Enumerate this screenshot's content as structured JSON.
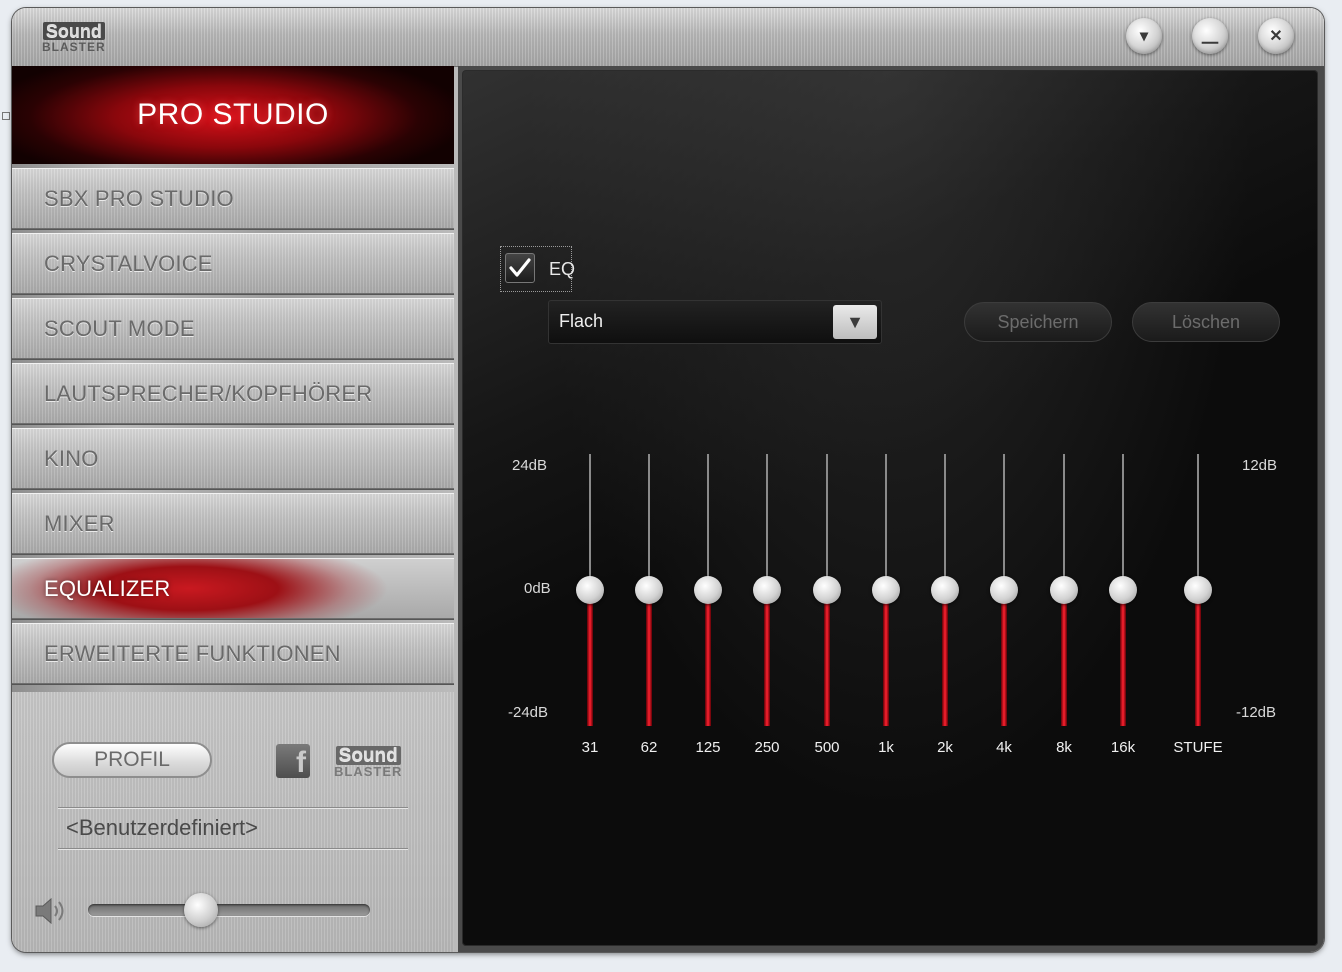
{
  "window": {
    "logo_line1": "Sound",
    "logo_line2": "BLASTER",
    "buttons": [
      {
        "name": "menu-down",
        "icon": "chevron-down-icon",
        "glyph": "▾"
      },
      {
        "name": "minimize",
        "icon": "minimize-icon",
        "glyph": "⎽"
      },
      {
        "name": "close",
        "icon": "close-icon",
        "glyph": "✕"
      }
    ]
  },
  "sidebar": {
    "brand": "PRO STUDIO",
    "items": [
      {
        "label": "SBX PRO STUDIO",
        "active": false
      },
      {
        "label": "CRYSTALVOICE",
        "active": false
      },
      {
        "label": "SCOUT MODE",
        "active": false
      },
      {
        "label": "LAUTSPRECHER/KOPFHÖRER",
        "active": false
      },
      {
        "label": "KINO",
        "active": false
      },
      {
        "label": "MIXER",
        "active": false
      },
      {
        "label": "EQUALIZER",
        "active": true
      },
      {
        "label": "ERWEITERTE FUNKTIONEN",
        "active": false
      }
    ],
    "profile_button": "PROFIL",
    "facebook_icon": "facebook-icon",
    "logo_line1": "Sound",
    "logo_line2": "BLASTER",
    "profile_name": "<Benutzerdefiniert>",
    "volume": {
      "icon": "speaker-icon",
      "level": 0.4
    }
  },
  "equalizer": {
    "eq_enabled": true,
    "eq_label": "EQ",
    "preset": "Flach",
    "save_label": "Speichern",
    "delete_label": "Löschen",
    "left_scale": {
      "top": "24dB",
      "mid": "0dB",
      "bottom": "-24dB"
    },
    "right_scale": {
      "top": "12dB",
      "bottom": "-12dB"
    },
    "bands": [
      {
        "label": "31",
        "value": 0
      },
      {
        "label": "62",
        "value": 0
      },
      {
        "label": "125",
        "value": 0
      },
      {
        "label": "250",
        "value": 0
      },
      {
        "label": "500",
        "value": 0
      },
      {
        "label": "1k",
        "value": 0
      },
      {
        "label": "2k",
        "value": 0
      },
      {
        "label": "4k",
        "value": 0
      },
      {
        "label": "8k",
        "value": 0
      },
      {
        "label": "16k",
        "value": 0
      },
      {
        "label": "STUFE",
        "value": 0
      }
    ],
    "accent_color": "#e0101c"
  }
}
